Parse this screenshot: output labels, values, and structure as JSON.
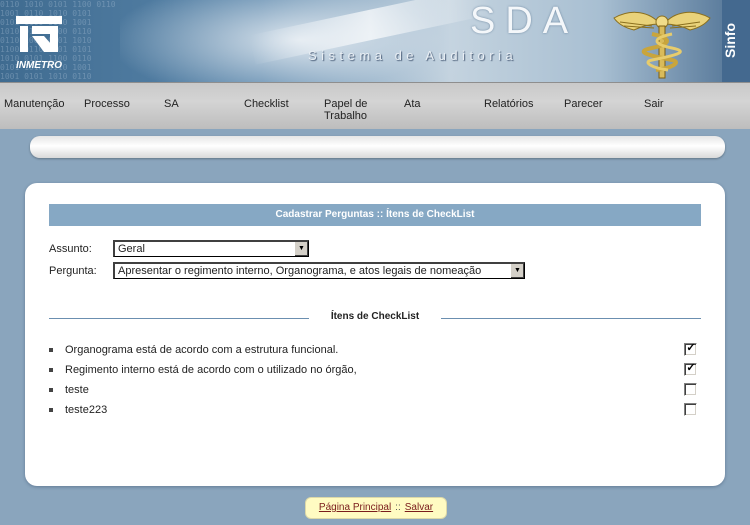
{
  "header": {
    "logo_text": "INMETRO",
    "title": "SDA",
    "subtitle": "Sistema de Auditoria",
    "brand": "Sinfo",
    "binary_pattern": ""
  },
  "menu": {
    "items": [
      {
        "label": "Manutenção",
        "name": "menu-manutencao"
      },
      {
        "label": "Processo",
        "name": "menu-processo"
      },
      {
        "label": "SA",
        "name": "menu-sa"
      },
      {
        "label": "Checklist",
        "name": "menu-checklist"
      },
      {
        "label": "Papel de Trabalho",
        "name": "menu-papel-de-trabalho"
      },
      {
        "label": "Ata",
        "name": "menu-ata"
      },
      {
        "label": "Relatórios",
        "name": "menu-relatorios"
      },
      {
        "label": "Parecer",
        "name": "menu-parecer"
      },
      {
        "label": "Sair",
        "name": "menu-sair"
      }
    ]
  },
  "form": {
    "title": "Cadastrar Perguntas :: Ítens de CheckList",
    "assunto_label": "Assunto:",
    "assunto_value": "Geral",
    "pergunta_label": "Pergunta:",
    "pergunta_value": "Apresentar o regimento interno, Organograma, e atos legais de nomeação",
    "section_title": "Ítens de CheckList",
    "items": [
      {
        "label": "Organograma está de acordo com a estrutura funcional.",
        "checked": true
      },
      {
        "label": "Regimento interno está de acordo com o utilizado no órgão,",
        "checked": true
      },
      {
        "label": "teste",
        "checked": false
      },
      {
        "label": "teste223",
        "checked": false
      }
    ]
  },
  "footer": {
    "home_link": "Página Principal",
    "separator": "::",
    "save_link": "Salvar"
  },
  "colors": {
    "page_bg": "#8aa5bd",
    "title_bar": "#86a8c4",
    "footer_bg": "#fffbc2",
    "link": "#7a1c1c"
  }
}
